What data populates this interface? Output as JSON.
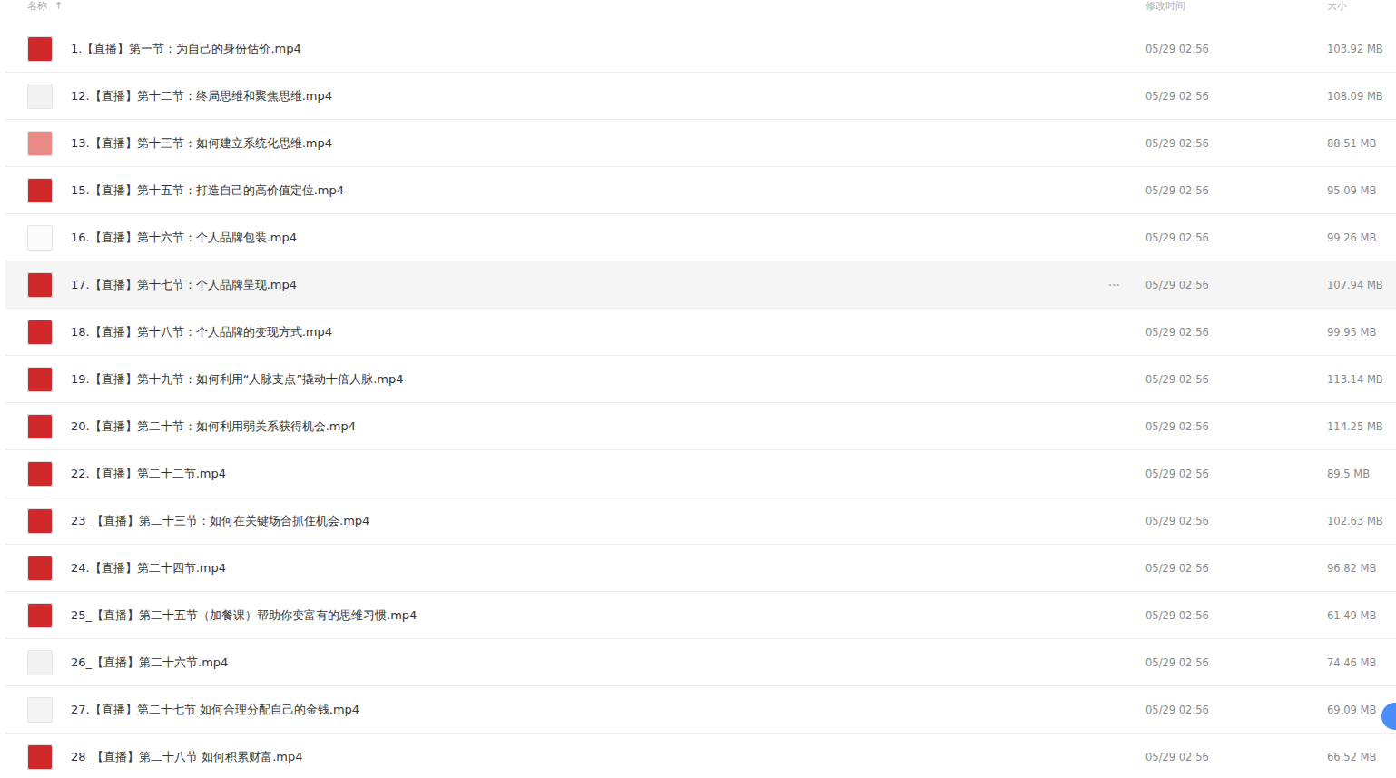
{
  "header": {
    "name": "名称",
    "sort_icon": "↑",
    "time": "修改时间",
    "size": "大小"
  },
  "more_icon": "···",
  "files": [
    {
      "name": "1.【直播】第一节：为自己的身份估价.mp4",
      "time": "05/29 02:56",
      "size": "103.92 MB",
      "hovered": false,
      "color": "#d0272b"
    },
    {
      "name": "12.【直播】第十二节：终局思维和聚焦思维.mp4",
      "time": "05/29 02:56",
      "size": "108.09 MB",
      "hovered": false,
      "color": "#f2f2f2"
    },
    {
      "name": "13.【直播】第十三节：如何建立系统化思维.mp4",
      "time": "05/29 02:56",
      "size": "88.51 MB",
      "hovered": false,
      "color": "#e98a86"
    },
    {
      "name": "15.【直播】第十五节：打造自己的高价值定位.mp4",
      "time": "05/29 02:56",
      "size": "95.09 MB",
      "hovered": false,
      "color": "#d0272b"
    },
    {
      "name": "16.【直播】第十六节：个人品牌包装.mp4",
      "time": "05/29 02:56",
      "size": "99.26 MB",
      "hovered": false,
      "color": "#fbfbfb"
    },
    {
      "name": "17.【直播】第十七节：个人品牌呈现.mp4",
      "time": "05/29 02:56",
      "size": "107.94 MB",
      "hovered": true,
      "color": "#d0272b"
    },
    {
      "name": "18.【直播】第十八节：个人品牌的变现方式.mp4",
      "time": "05/29 02:56",
      "size": "99.95 MB",
      "hovered": false,
      "color": "#d0272b"
    },
    {
      "name": "19.【直播】第十九节：如何利用“人脉支点”撬动十倍人脉.mp4",
      "time": "05/29 02:56",
      "size": "113.14 MB",
      "hovered": false,
      "color": "#d0272b"
    },
    {
      "name": "20.【直播】第二十节：如何利用弱关系获得机会.mp4",
      "time": "05/29 02:56",
      "size": "114.25 MB",
      "hovered": false,
      "color": "#d0272b"
    },
    {
      "name": "22.【直播】第二十二节.mp4",
      "time": "05/29 02:56",
      "size": "89.5 MB",
      "hovered": false,
      "color": "#d0272b"
    },
    {
      "name": "23_【直播】第二十三节：如何在关键场合抓住机会.mp4",
      "time": "05/29 02:56",
      "size": "102.63 MB",
      "hovered": false,
      "color": "#d0272b"
    },
    {
      "name": "24.【直播】第二十四节.mp4",
      "time": "05/29 02:56",
      "size": "96.82 MB",
      "hovered": false,
      "color": "#d0272b"
    },
    {
      "name": "25_【直播】第二十五节（加餐课）帮助你变富有的思维习惯.mp4",
      "time": "05/29 02:56",
      "size": "61.49 MB",
      "hovered": false,
      "color": "#d0272b"
    },
    {
      "name": "26_【直播】第二十六节.mp4",
      "time": "05/29 02:56",
      "size": "74.46 MB",
      "hovered": false,
      "color": "#f2f2f2"
    },
    {
      "name": "27.【直播】第二十七节 如何合理分配自己的金钱.mp4",
      "time": "05/29 02:56",
      "size": "69.09 MB",
      "hovered": false,
      "color": "#f4f4f4"
    },
    {
      "name": "28_【直播】第二十八节 如何积累财富.mp4",
      "time": "05/29 02:56",
      "size": "66.52 MB",
      "hovered": false,
      "color": "#d0272b"
    }
  ]
}
